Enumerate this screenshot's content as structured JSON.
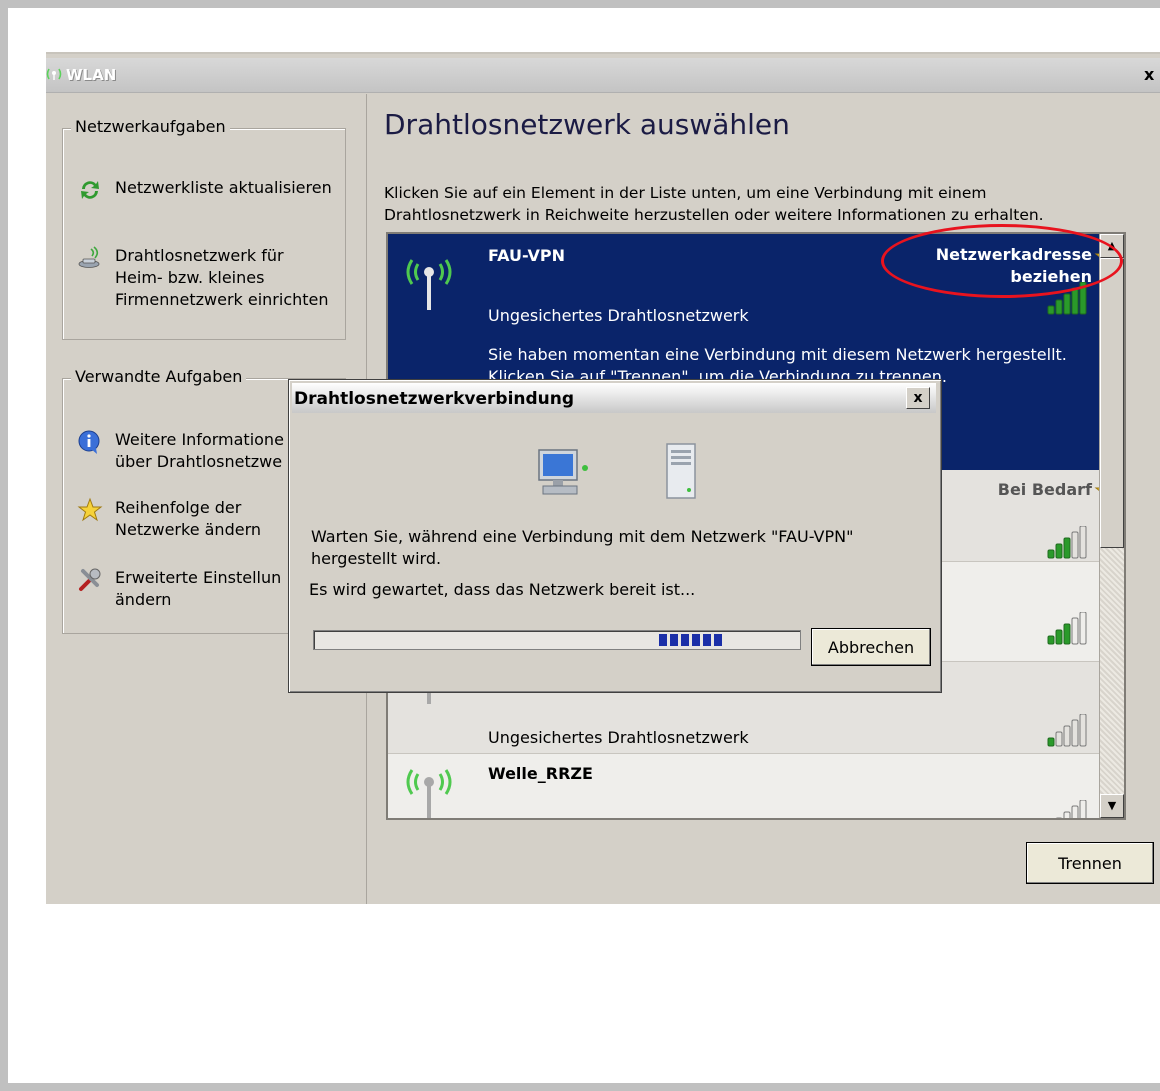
{
  "window": {
    "title": "WLAN",
    "close_glyph": "x"
  },
  "left_pane": {
    "network_tasks": {
      "title": "Netzwerkaufgaben",
      "items": [
        {
          "label": "Netzwerkliste aktualisieren",
          "icon": "refresh-icon"
        },
        {
          "label": "Drahtlosnetzwerk für\nHeim- bzw. kleines\nFirmennetzwerk einrichten",
          "icon": "wireless-setup-icon"
        }
      ]
    },
    "related_tasks": {
      "title": "Verwandte Aufgaben",
      "items": [
        {
          "label": "Weitere Informatione\nüber Drahtlosnetzwe",
          "icon": "info-icon"
        },
        {
          "label": "Reihenfolge der\nNetzwerke ändern",
          "icon": "star-icon"
        },
        {
          "label": "Erweiterte Einstellun\nändern",
          "icon": "tools-icon"
        }
      ]
    }
  },
  "main": {
    "heading": "Drahtlosnetzwerk auswählen",
    "instructions": "Klicken Sie auf ein Element in der Liste unten, um eine Verbindung mit einem\nDrahtlosnetzwerk in Reichweite herzustellen oder weitere Informationen zu erhalten."
  },
  "networks": [
    {
      "name": "FAU-VPN",
      "status": "Netzwerkadresse\nbeziehen",
      "security": "Ungesichertes Drahtlosnetzwerk",
      "description": "Sie haben momentan eine Verbindung mit diesem Netzwerk hergestellt.\nKlicken Sie auf \"Trennen\", um die Verbindung zu trennen.",
      "signal_bars": 5
    },
    {
      "name": "",
      "status": "Bei Bedarf",
      "security": "",
      "signal_bars": 3
    },
    {
      "name": "",
      "status": "",
      "security": "",
      "signal_bars": 3
    },
    {
      "name": "",
      "status": "",
      "security": "Ungesichertes Drahtlosnetzwerk",
      "signal_bars": 1
    },
    {
      "name": "Welle_RRZE",
      "status": "",
      "security": "",
      "signal_bars": 1
    }
  ],
  "disconnect_button": "Trennen",
  "dialog": {
    "title": "Drahtlosnetzwerkverbindung",
    "message": "Warten Sie, während eine Verbindung mit dem Netzwerk \"FAU-VPN\" hergestellt wird.",
    "status": "Es wird gewartet, dass das Netzwerk bereit ist...",
    "cancel_label": "Abbrechen",
    "progress_position_pct": 71,
    "close_glyph": "x"
  },
  "colors": {
    "selection": "#0a246a",
    "signal_green": "#2a9a2a",
    "annotation": "#e8131e",
    "progress_block": "#1b2fa8"
  }
}
